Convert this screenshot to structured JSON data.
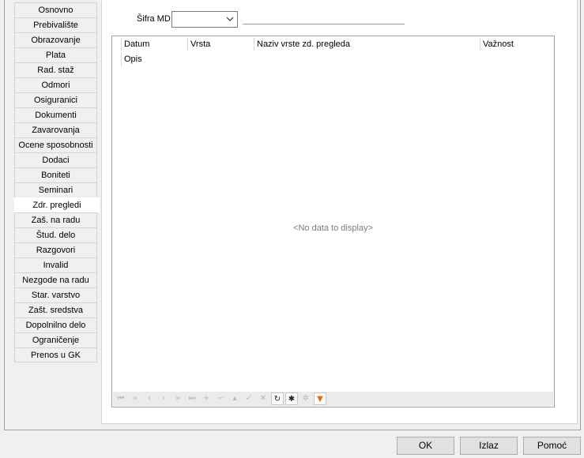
{
  "tabs": [
    {
      "label": "Osnovno"
    },
    {
      "label": "Prebivalište"
    },
    {
      "label": "Obrazovanje"
    },
    {
      "label": "Plata"
    },
    {
      "label": "Rad. staž"
    },
    {
      "label": "Odmori"
    },
    {
      "label": "Osiguranici"
    },
    {
      "label": "Dokumenti"
    },
    {
      "label": "Zavarovanja"
    },
    {
      "label": "Ocene sposobnosti"
    },
    {
      "label": "Dodaci"
    },
    {
      "label": "Boniteti"
    },
    {
      "label": "Seminari"
    },
    {
      "label": "Zdr. pregledi",
      "active": true
    },
    {
      "label": "Zaš. na radu"
    },
    {
      "label": "Štud. delo"
    },
    {
      "label": "Razgovori"
    },
    {
      "label": "Invalid"
    },
    {
      "label": "Nezgode na radu"
    },
    {
      "label": "Star. varstvo"
    },
    {
      "label": "Zašt. sredstva"
    },
    {
      "label": "Dopolnilno delo"
    },
    {
      "label": "Ograničenje"
    },
    {
      "label": "Prenos u GK"
    }
  ],
  "filter": {
    "sifra_label": "Šifra MD",
    "sifra_value": "",
    "sifra_description": ""
  },
  "grid": {
    "columns": [
      "Datum",
      "Vrsta",
      "Naziv vrste zd. pregleda",
      "Važnost"
    ],
    "second_row_column": "Opis",
    "empty_text": "<No data to display>",
    "navigator": [
      {
        "icon": "first-icon",
        "glyph": "⏮",
        "enabled": false
      },
      {
        "icon": "prev-page-icon",
        "glyph": "«",
        "enabled": false
      },
      {
        "icon": "prev-icon",
        "glyph": "‹",
        "enabled": false
      },
      {
        "icon": "next-icon",
        "glyph": "›",
        "enabled": false
      },
      {
        "icon": "next-page-icon",
        "glyph": "»",
        "enabled": false
      },
      {
        "icon": "last-icon",
        "glyph": "⏭",
        "enabled": false
      },
      {
        "icon": "insert-icon",
        "glyph": "+",
        "enabled": false
      },
      {
        "icon": "delete-icon",
        "glyph": "−",
        "enabled": false
      },
      {
        "icon": "edit-icon",
        "glyph": "▴",
        "enabled": false
      },
      {
        "icon": "post-icon",
        "glyph": "✓",
        "enabled": false
      },
      {
        "icon": "cancel-icon",
        "glyph": "✕",
        "enabled": false
      },
      {
        "icon": "refresh-icon",
        "glyph": "↻",
        "enabled": true
      },
      {
        "icon": "bookmark-icon",
        "glyph": "✱",
        "enabled": true
      },
      {
        "icon": "goto-bookmark-icon",
        "glyph": "✲",
        "enabled": false
      },
      {
        "icon": "filter-icon",
        "glyph": "▼",
        "enabled": true,
        "color": "#e07010"
      }
    ]
  },
  "buttons": {
    "ok": "OK",
    "izlaz": "Izlaz",
    "pomoc": "Pomoć"
  }
}
